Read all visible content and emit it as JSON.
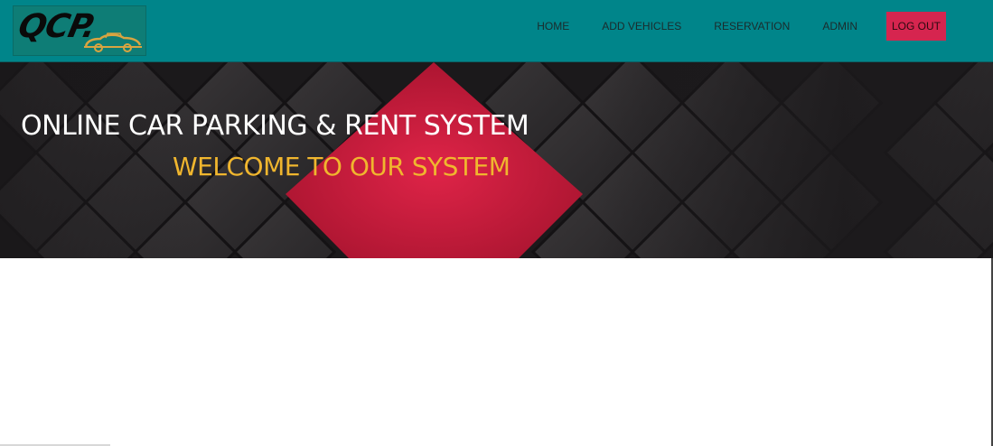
{
  "brand": {
    "logo_text": "QCP.",
    "logo_icon": "car-icon",
    "logo_accent": "#d9a441"
  },
  "nav": {
    "items": [
      {
        "label": "HOME",
        "name": "nav-home"
      },
      {
        "label": "ADD VEHICLES",
        "name": "nav-add-vehicles"
      },
      {
        "label": "RESERVATION",
        "name": "nav-reservation"
      },
      {
        "label": "ADMIN",
        "name": "nav-admin"
      }
    ],
    "logout_label": "LOG OUT"
  },
  "hero": {
    "title": "ONLINE CAR PARKING & RENT SYSTEM",
    "subtitle": "WELCOME TO OUR SYSTEM"
  },
  "colors": {
    "navbar_bg": "#00858a",
    "logout_bg": "#d6254f",
    "hero_accent": "#d21f41",
    "subtitle": "#f0b62e"
  }
}
